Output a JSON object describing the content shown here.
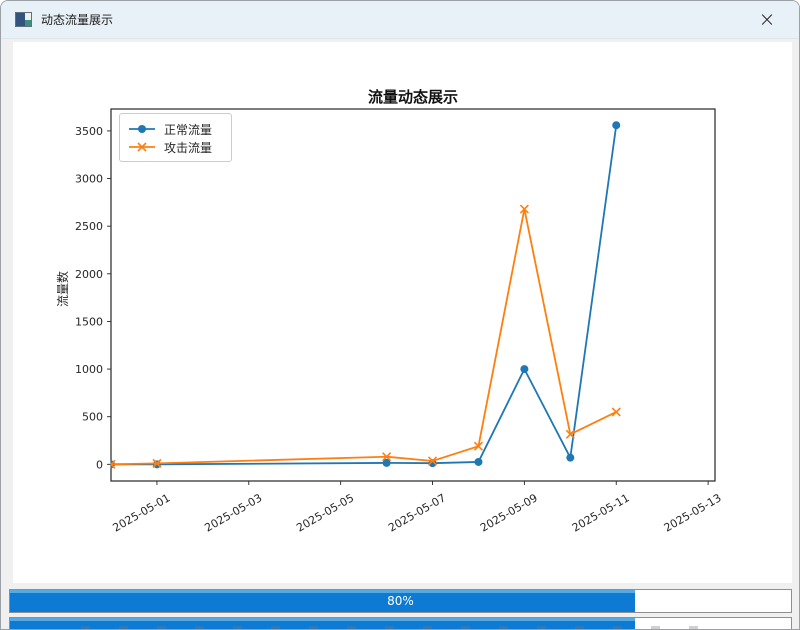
{
  "window": {
    "title": "动态流量展示",
    "close_glyph": "×"
  },
  "progress": {
    "label": "80%",
    "percent": 80,
    "second_percent": 80
  },
  "chart_data": {
    "type": "line",
    "title": "流量动态展示",
    "ylabel": "流量数",
    "xlabel": "",
    "x_base": "2025-05-01",
    "x_dates": [
      "2025-04-30",
      "2025-05-01",
      "2025-05-06",
      "2025-05-07",
      "2025-05-08",
      "2025-05-09",
      "2025-05-10",
      "2025-05-11"
    ],
    "series": [
      {
        "name": "正常流量",
        "marker": "circle",
        "color": "#1f77b4",
        "values": [
          0,
          0,
          15,
          12,
          25,
          1000,
          70,
          3560
        ]
      },
      {
        "name": "攻击流量",
        "marker": "x",
        "color": "#ff7f0e",
        "values": [
          0,
          10,
          80,
          35,
          190,
          2680,
          315,
          550
        ]
      }
    ],
    "x_tick_labels": [
      "2025-05-01",
      "2025-05-03",
      "2025-05-05",
      "2025-05-07",
      "2025-05-09",
      "2025-05-11",
      "2025-05-13"
    ],
    "y_ticks": [
      0,
      500,
      1000,
      1500,
      2000,
      2500,
      3000,
      3500
    ],
    "xlim_days": [
      -1,
      12.15
    ],
    "ylim": [
      -175,
      3730
    ],
    "legend_position": "upper left",
    "grid": false
  }
}
